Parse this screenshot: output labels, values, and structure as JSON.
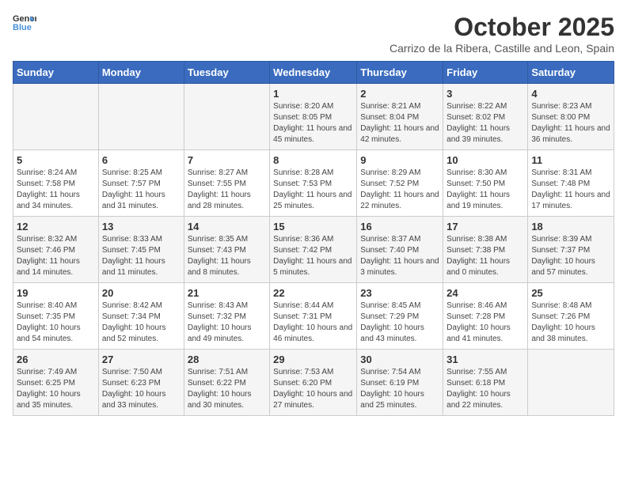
{
  "logo": {
    "line1": "General",
    "line2": "Blue"
  },
  "title": "October 2025",
  "subtitle": "Carrizo de la Ribera, Castille and Leon, Spain",
  "headers": [
    "Sunday",
    "Monday",
    "Tuesday",
    "Wednesday",
    "Thursday",
    "Friday",
    "Saturday"
  ],
  "weeks": [
    [
      {
        "day": "",
        "info": ""
      },
      {
        "day": "",
        "info": ""
      },
      {
        "day": "",
        "info": ""
      },
      {
        "day": "1",
        "info": "Sunrise: 8:20 AM\nSunset: 8:05 PM\nDaylight: 11 hours and 45 minutes."
      },
      {
        "day": "2",
        "info": "Sunrise: 8:21 AM\nSunset: 8:04 PM\nDaylight: 11 hours and 42 minutes."
      },
      {
        "day": "3",
        "info": "Sunrise: 8:22 AM\nSunset: 8:02 PM\nDaylight: 11 hours and 39 minutes."
      },
      {
        "day": "4",
        "info": "Sunrise: 8:23 AM\nSunset: 8:00 PM\nDaylight: 11 hours and 36 minutes."
      }
    ],
    [
      {
        "day": "5",
        "info": "Sunrise: 8:24 AM\nSunset: 7:58 PM\nDaylight: 11 hours and 34 minutes."
      },
      {
        "day": "6",
        "info": "Sunrise: 8:25 AM\nSunset: 7:57 PM\nDaylight: 11 hours and 31 minutes."
      },
      {
        "day": "7",
        "info": "Sunrise: 8:27 AM\nSunset: 7:55 PM\nDaylight: 11 hours and 28 minutes."
      },
      {
        "day": "8",
        "info": "Sunrise: 8:28 AM\nSunset: 7:53 PM\nDaylight: 11 hours and 25 minutes."
      },
      {
        "day": "9",
        "info": "Sunrise: 8:29 AM\nSunset: 7:52 PM\nDaylight: 11 hours and 22 minutes."
      },
      {
        "day": "10",
        "info": "Sunrise: 8:30 AM\nSunset: 7:50 PM\nDaylight: 11 hours and 19 minutes."
      },
      {
        "day": "11",
        "info": "Sunrise: 8:31 AM\nSunset: 7:48 PM\nDaylight: 11 hours and 17 minutes."
      }
    ],
    [
      {
        "day": "12",
        "info": "Sunrise: 8:32 AM\nSunset: 7:46 PM\nDaylight: 11 hours and 14 minutes."
      },
      {
        "day": "13",
        "info": "Sunrise: 8:33 AM\nSunset: 7:45 PM\nDaylight: 11 hours and 11 minutes."
      },
      {
        "day": "14",
        "info": "Sunrise: 8:35 AM\nSunset: 7:43 PM\nDaylight: 11 hours and 8 minutes."
      },
      {
        "day": "15",
        "info": "Sunrise: 8:36 AM\nSunset: 7:42 PM\nDaylight: 11 hours and 5 minutes."
      },
      {
        "day": "16",
        "info": "Sunrise: 8:37 AM\nSunset: 7:40 PM\nDaylight: 11 hours and 3 minutes."
      },
      {
        "day": "17",
        "info": "Sunrise: 8:38 AM\nSunset: 7:38 PM\nDaylight: 11 hours and 0 minutes."
      },
      {
        "day": "18",
        "info": "Sunrise: 8:39 AM\nSunset: 7:37 PM\nDaylight: 10 hours and 57 minutes."
      }
    ],
    [
      {
        "day": "19",
        "info": "Sunrise: 8:40 AM\nSunset: 7:35 PM\nDaylight: 10 hours and 54 minutes."
      },
      {
        "day": "20",
        "info": "Sunrise: 8:42 AM\nSunset: 7:34 PM\nDaylight: 10 hours and 52 minutes."
      },
      {
        "day": "21",
        "info": "Sunrise: 8:43 AM\nSunset: 7:32 PM\nDaylight: 10 hours and 49 minutes."
      },
      {
        "day": "22",
        "info": "Sunrise: 8:44 AM\nSunset: 7:31 PM\nDaylight: 10 hours and 46 minutes."
      },
      {
        "day": "23",
        "info": "Sunrise: 8:45 AM\nSunset: 7:29 PM\nDaylight: 10 hours and 43 minutes."
      },
      {
        "day": "24",
        "info": "Sunrise: 8:46 AM\nSunset: 7:28 PM\nDaylight: 10 hours and 41 minutes."
      },
      {
        "day": "25",
        "info": "Sunrise: 8:48 AM\nSunset: 7:26 PM\nDaylight: 10 hours and 38 minutes."
      }
    ],
    [
      {
        "day": "26",
        "info": "Sunrise: 7:49 AM\nSunset: 6:25 PM\nDaylight: 10 hours and 35 minutes."
      },
      {
        "day": "27",
        "info": "Sunrise: 7:50 AM\nSunset: 6:23 PM\nDaylight: 10 hours and 33 minutes."
      },
      {
        "day": "28",
        "info": "Sunrise: 7:51 AM\nSunset: 6:22 PM\nDaylight: 10 hours and 30 minutes."
      },
      {
        "day": "29",
        "info": "Sunrise: 7:53 AM\nSunset: 6:20 PM\nDaylight: 10 hours and 27 minutes."
      },
      {
        "day": "30",
        "info": "Sunrise: 7:54 AM\nSunset: 6:19 PM\nDaylight: 10 hours and 25 minutes."
      },
      {
        "day": "31",
        "info": "Sunrise: 7:55 AM\nSunset: 6:18 PM\nDaylight: 10 hours and 22 minutes."
      },
      {
        "day": "",
        "info": ""
      }
    ]
  ]
}
